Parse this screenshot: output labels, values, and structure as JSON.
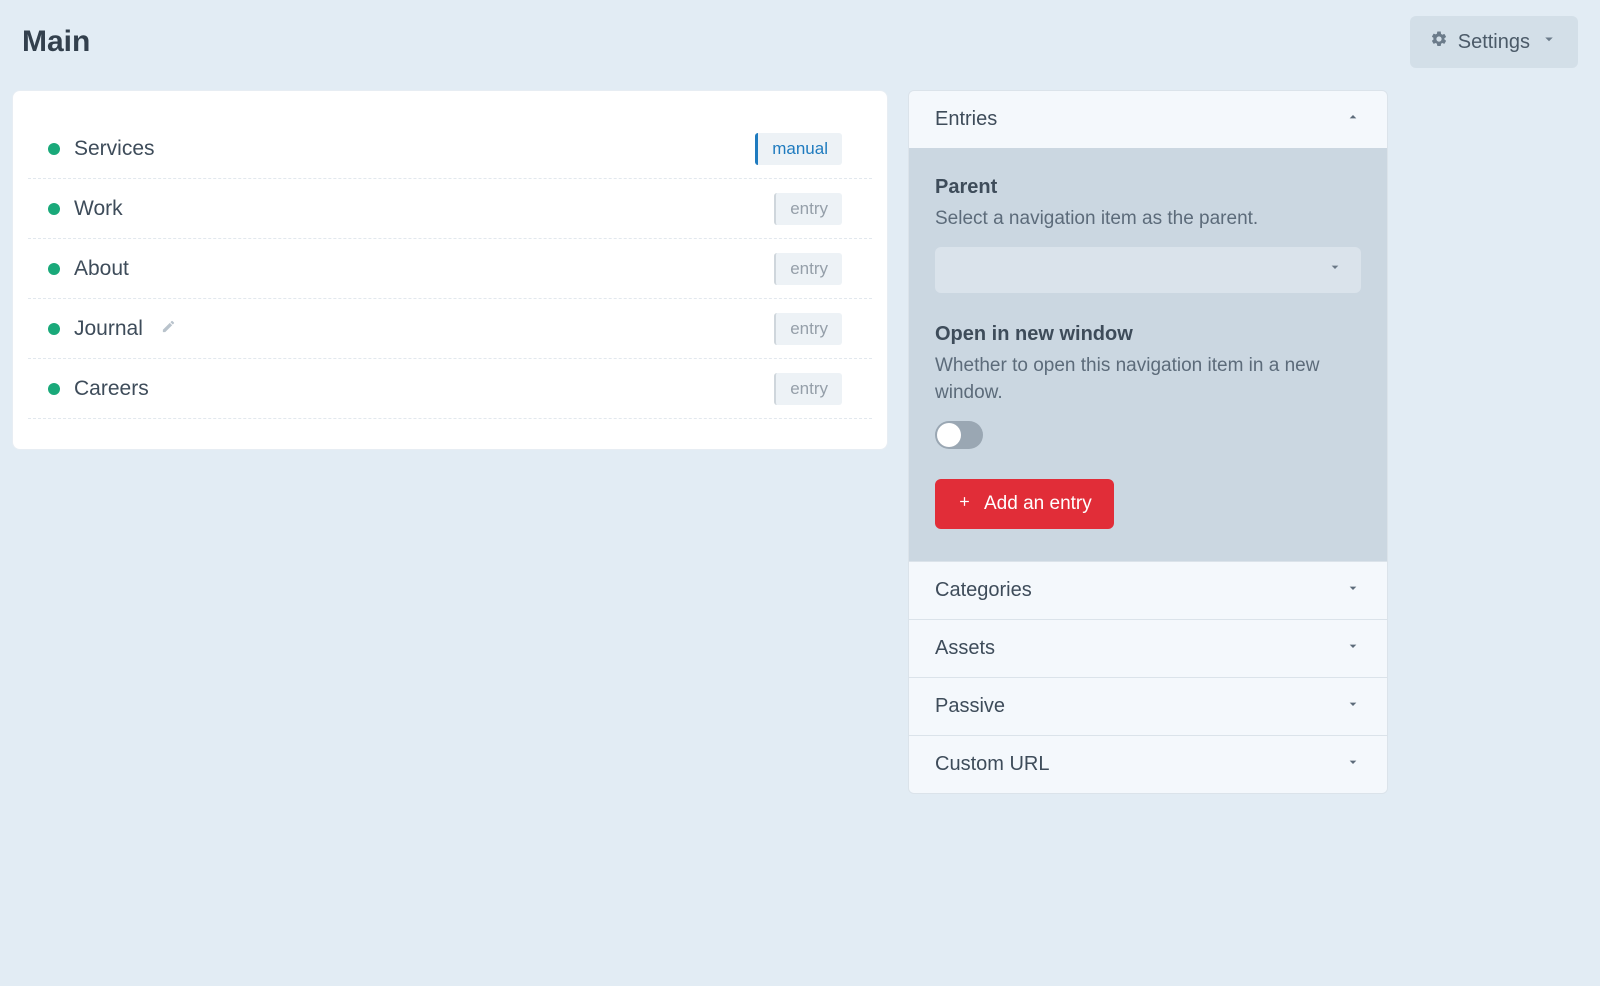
{
  "page": {
    "title": "Main"
  },
  "header": {
    "settings_label": "Settings"
  },
  "nav": {
    "items": [
      {
        "label": "Services",
        "tag": "manual",
        "tag_kind": "manual",
        "editable": false
      },
      {
        "label": "Work",
        "tag": "entry",
        "tag_kind": "entry",
        "editable": false
      },
      {
        "label": "About",
        "tag": "entry",
        "tag_kind": "entry",
        "editable": false
      },
      {
        "label": "Journal",
        "tag": "entry",
        "tag_kind": "entry",
        "editable": true
      },
      {
        "label": "Careers",
        "tag": "entry",
        "tag_kind": "entry",
        "editable": false
      }
    ]
  },
  "sidebar": {
    "sections": [
      {
        "title": "Entries",
        "expanded": true
      },
      {
        "title": "Categories",
        "expanded": false
      },
      {
        "title": "Assets",
        "expanded": false
      },
      {
        "title": "Passive",
        "expanded": false
      },
      {
        "title": "Custom URL",
        "expanded": false
      }
    ],
    "entries_panel": {
      "parent": {
        "label": "Parent",
        "desc": "Select a navigation item as the parent.",
        "value": ""
      },
      "new_window": {
        "label": "Open in new window",
        "desc": "Whether to open this navigation item in a new window.",
        "value": false
      },
      "add_button_label": "Add an entry"
    }
  },
  "colors": {
    "accent_red": "#e12d38",
    "status_green": "#1aa97a",
    "link_blue": "#1f7bbf"
  }
}
